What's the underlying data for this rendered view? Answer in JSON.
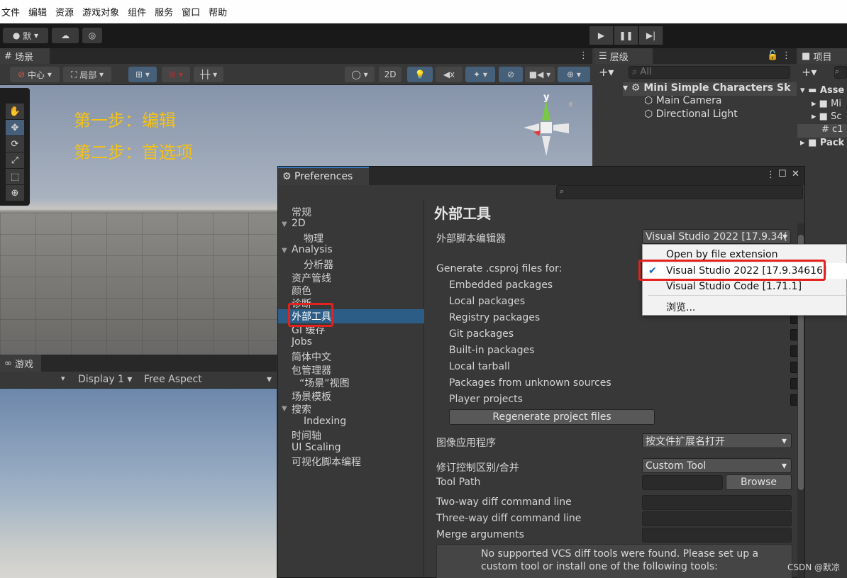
{
  "menubar": {
    "items": [
      "文件",
      "编辑",
      "资源",
      "游戏对象",
      "组件",
      "服务",
      "窗口",
      "帮助"
    ]
  },
  "toolbar": {
    "account_label": "默",
    "icons": [
      "account-icon",
      "cloud-icon",
      "collab-icon",
      "play-icon",
      "pause-icon",
      "step-icon"
    ]
  },
  "scene": {
    "tab_label": "场景",
    "pivot_label": "中心",
    "space_label": "局部",
    "mode_2d": "2D",
    "steps": [
      "第一步：编辑",
      "第二步：首选项"
    ],
    "gizmo_y": "y"
  },
  "game": {
    "tab_label": "游戏",
    "display": "Display 1",
    "aspect": "Free Aspect"
  },
  "hierarchy": {
    "tab_label": "层级",
    "search_placeholder": "All",
    "scene_name": "Mini Simple Characters Sk",
    "objects": [
      "Main Camera",
      "Directional Light"
    ]
  },
  "project": {
    "tab_label": "项目",
    "items": [
      "Asse",
      "Mi",
      "Sc",
      "c1",
      "Pack"
    ]
  },
  "preferences": {
    "title": "Preferences",
    "categories": [
      "常规",
      "2D",
      "物理",
      "Analysis",
      "分析器",
      "资产管线",
      "颜色",
      "诊断",
      "外部工具",
      "GI 缓存",
      "Jobs",
      "简体中文",
      "包管理器",
      "“场景”视图",
      "场景模板",
      "搜索",
      "Indexing",
      "时间轴",
      "UI Scaling",
      "可视化脚本编程"
    ],
    "selected_category": "外部工具",
    "section_title": "外部工具",
    "script_editor_label": "外部脚本编辑器",
    "script_editor_value": "Visual Studio 2022 [17.9.34(",
    "csproj_label": "Generate .csproj files for:",
    "csproj_options": [
      "Embedded packages",
      "Local packages",
      "Registry packages",
      "Git packages",
      "Built-in packages",
      "Local tarball",
      "Packages from unknown sources",
      "Player projects"
    ],
    "regenerate_label": "Regenerate project files",
    "image_app_label": "图像应用程序",
    "image_app_value": "按文件扩展名打开",
    "revision_label": "修订控制区别/合并",
    "revision_value": "Custom Tool",
    "tool_path_label": "Tool Path",
    "browse_label": "Browse",
    "two_way_label": "Two-way diff command line",
    "three_way_label": "Three-way diff command line",
    "merge_label": "Merge arguments",
    "help_text": "No supported VCS diff tools were found. Please set up a custom tool or install one of the following tools:"
  },
  "popup": {
    "items": [
      "Open by file extension",
      "Visual Studio 2022 [17.9.34616]",
      "Visual Studio Code [1.71.1]",
      "浏览..."
    ],
    "checked_index": 1
  },
  "watermark": "CSDN @默凉",
  "colors": {
    "accent": "#2c5d87",
    "highlight": "#e3211e",
    "step_text": "#f4c214"
  }
}
